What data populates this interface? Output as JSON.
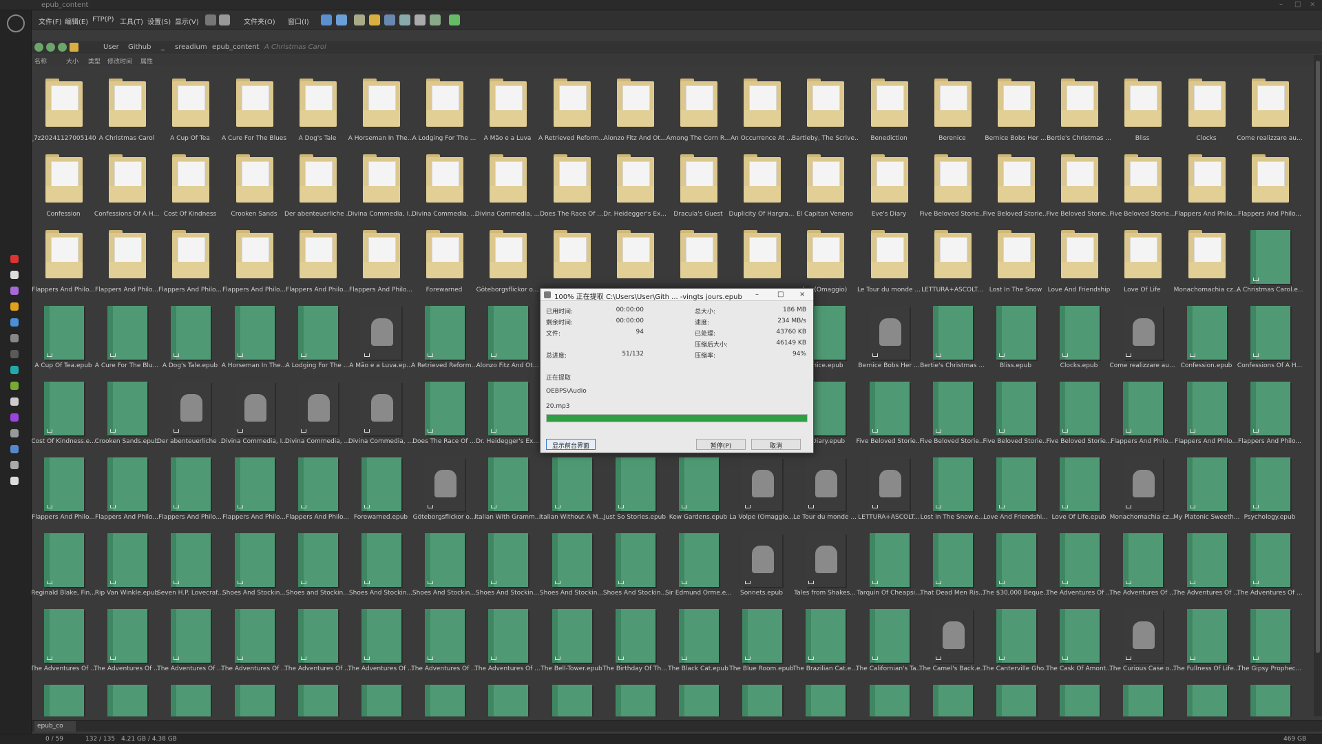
{
  "window": {
    "title": "epub_content"
  },
  "menu": [
    "文件(F)",
    "编辑(E)",
    "FTP(P)",
    "工具(T)",
    "设置(S)",
    "显示(V)",
    "文件夹(O)",
    "窗口(I)"
  ],
  "breadcrumb": [
    "User",
    "Github",
    "_",
    "sreadium",
    "epub_content",
    "A Christmas Carol"
  ],
  "columns": [
    "名称",
    "大小",
    "类型",
    "修改时间",
    "属性"
  ],
  "items": [
    {
      "label": "_7z20241127005140",
      "kind": "folder"
    },
    {
      "label": "A Christmas Carol",
      "kind": "folder"
    },
    {
      "label": "A Cup Of Tea",
      "kind": "folder"
    },
    {
      "label": "A Cure For The Blues",
      "kind": "folder"
    },
    {
      "label": "A Dog's Tale",
      "kind": "folder"
    },
    {
      "label": "A Horseman In The...",
      "kind": "folder"
    },
    {
      "label": "A Lodging For The ...",
      "kind": "folder"
    },
    {
      "label": "A Mão e a Luva",
      "kind": "folder"
    },
    {
      "label": "A Retrieved Reform...",
      "kind": "folder"
    },
    {
      "label": "Alonzo Fitz And Ot...",
      "kind": "folder"
    },
    {
      "label": "Among The Corn R...",
      "kind": "folder"
    },
    {
      "label": "An Occurrence At ...",
      "kind": "folder"
    },
    {
      "label": "Bartleby, The Scrive...",
      "kind": "folder"
    },
    {
      "label": "Benediction",
      "kind": "folder"
    },
    {
      "label": "Berenice",
      "kind": "folder"
    },
    {
      "label": "Bernice Bobs Her ...",
      "kind": "folder"
    },
    {
      "label": "Bertie's Christmas ...",
      "kind": "folder"
    },
    {
      "label": "Bliss",
      "kind": "folder"
    },
    {
      "label": "Clocks",
      "kind": "folder"
    },
    {
      "label": "Come realizzare au...",
      "kind": "folder"
    },
    {
      "label": "Confession",
      "kind": "folder"
    },
    {
      "label": "Confessions Of A H...",
      "kind": "folder"
    },
    {
      "label": "Cost Of Kindness",
      "kind": "folder"
    },
    {
      "label": "Crooken Sands",
      "kind": "folder"
    },
    {
      "label": "Der abenteuerliche ...",
      "kind": "folder"
    },
    {
      "label": "Divina Commedia, I...",
      "kind": "folder"
    },
    {
      "label": "Divina Commedia, ...",
      "kind": "folder"
    },
    {
      "label": "Divina Commedia, ...",
      "kind": "folder"
    },
    {
      "label": "Does The Race Of ...",
      "kind": "folder"
    },
    {
      "label": "Dr. Heidegger's Ex...",
      "kind": "folder"
    },
    {
      "label": "Dracula's Guest",
      "kind": "folder"
    },
    {
      "label": "Duplicity Of Hargra...",
      "kind": "folder"
    },
    {
      "label": "El Capitan Veneno",
      "kind": "folder"
    },
    {
      "label": "Eve's Diary",
      "kind": "folder"
    },
    {
      "label": "Five Beloved Storie...",
      "kind": "folder"
    },
    {
      "label": "Five Beloved Storie...",
      "kind": "folder"
    },
    {
      "label": "Five Beloved Storie...",
      "kind": "folder"
    },
    {
      "label": "Five Beloved Storie...",
      "kind": "folder"
    },
    {
      "label": "Flappers And Philo...",
      "kind": "folder"
    },
    {
      "label": "Flappers And Philo...",
      "kind": "folder"
    },
    {
      "label": "Flappers And Philo...",
      "kind": "folder"
    },
    {
      "label": "Flappers And Philo...",
      "kind": "folder"
    },
    {
      "label": "Flappers And Philo...",
      "kind": "folder"
    },
    {
      "label": "Flappers And Philo...",
      "kind": "folder"
    },
    {
      "label": "Flappers And Philo...",
      "kind": "folder"
    },
    {
      "label": "Flappers And Philo...",
      "kind": "folder"
    },
    {
      "label": "Forewarned",
      "kind": "folder"
    },
    {
      "label": "Göteborgsflickor o...",
      "kind": "folder"
    },
    {
      "label": "",
      "kind": "folder"
    },
    {
      "label": "",
      "kind": "folder"
    },
    {
      "label": "",
      "kind": "folder"
    },
    {
      "label": "",
      "kind": "folder"
    },
    {
      "label": "lpe (Omaggio)",
      "kind": "folder"
    },
    {
      "label": "Le Tour du monde ...",
      "kind": "folder"
    },
    {
      "label": "LETTURA+ASCOLT...",
      "kind": "folder"
    },
    {
      "label": "Lost In The Snow",
      "kind": "folder"
    },
    {
      "label": "Love And Friendship",
      "kind": "folder"
    },
    {
      "label": "Love Of Life",
      "kind": "folder"
    },
    {
      "label": "Monachomachia cz...",
      "kind": "folder"
    },
    {
      "label": "A Christmas Carol.e...",
      "kind": "book"
    },
    {
      "label": "A Cup Of Tea.epub",
      "kind": "book"
    },
    {
      "label": "A Cure For The Blu...",
      "kind": "book"
    },
    {
      "label": "A Dog's Tale.epub",
      "kind": "book"
    },
    {
      "label": "A Horseman In The...",
      "kind": "book"
    },
    {
      "label": "A Lodging For The ...",
      "kind": "book"
    },
    {
      "label": "A Mão e a Luva.ep...",
      "kind": "portrait"
    },
    {
      "label": "A Retrieved Reform...",
      "kind": "book"
    },
    {
      "label": "Alonzo Fitz And Ot...",
      "kind": "book"
    },
    {
      "label": "",
      "kind": "book"
    },
    {
      "label": "",
      "kind": "book"
    },
    {
      "label": "",
      "kind": "book"
    },
    {
      "label": "",
      "kind": "book"
    },
    {
      "label": "renice.epub",
      "kind": "book"
    },
    {
      "label": "Bernice Bobs Her ...",
      "kind": "portrait"
    },
    {
      "label": "Bertie's Christmas ...",
      "kind": "book"
    },
    {
      "label": "Bliss.epub",
      "kind": "book"
    },
    {
      "label": "Clocks.epub",
      "kind": "book"
    },
    {
      "label": "Come realizzare au...",
      "kind": "portrait"
    },
    {
      "label": "Confession.epub",
      "kind": "book"
    },
    {
      "label": "Confessions Of A H...",
      "kind": "book"
    },
    {
      "label": "Cost Of Kindness.e...",
      "kind": "book"
    },
    {
      "label": "Crooken Sands.epub",
      "kind": "book"
    },
    {
      "label": "Der abenteuerliche ...",
      "kind": "portrait"
    },
    {
      "label": "Divina Commedia, I...",
      "kind": "portrait"
    },
    {
      "label": "Divina Commedia, ...",
      "kind": "portrait"
    },
    {
      "label": "Divina Commedia, ...",
      "kind": "portrait"
    },
    {
      "label": "Does The Race Of ...",
      "kind": "book"
    },
    {
      "label": "Dr. Heidegger's Ex...",
      "kind": "book"
    },
    {
      "label": "",
      "kind": "book"
    },
    {
      "label": "",
      "kind": "book"
    },
    {
      "label": "",
      "kind": "book"
    },
    {
      "label": "",
      "kind": "book"
    },
    {
      "label": "'s Diary.epub",
      "kind": "book"
    },
    {
      "label": "Five Beloved Storie...",
      "kind": "book"
    },
    {
      "label": "Five Beloved Storie...",
      "kind": "book"
    },
    {
      "label": "Five Beloved Storie...",
      "kind": "book"
    },
    {
      "label": "Five Beloved Storie...",
      "kind": "book"
    },
    {
      "label": "Flappers And Philo...",
      "kind": "book"
    },
    {
      "label": "Flappers And Philo...",
      "kind": "book"
    },
    {
      "label": "Flappers And Philo...",
      "kind": "book"
    },
    {
      "label": "Flappers And Philo...",
      "kind": "book"
    },
    {
      "label": "Flappers And Philo...",
      "kind": "book"
    },
    {
      "label": "Flappers And Philo...",
      "kind": "book"
    },
    {
      "label": "Flappers And Philo...",
      "kind": "book"
    },
    {
      "label": "Flappers And Philo...",
      "kind": "book"
    },
    {
      "label": "Forewarned.epub",
      "kind": "book"
    },
    {
      "label": "Göteborgsflickor o...",
      "kind": "portrait"
    },
    {
      "label": "Italian With Gramm...",
      "kind": "book"
    },
    {
      "label": "Italian Without A M...",
      "kind": "book"
    },
    {
      "label": "Just So Stories.epub",
      "kind": "book"
    },
    {
      "label": "Kew Gardens.epub",
      "kind": "book"
    },
    {
      "label": "La Volpe (Omaggio...",
      "kind": "portrait"
    },
    {
      "label": "Le Tour du monde ...",
      "kind": "portrait"
    },
    {
      "label": "LETTURA+ASCOLT...",
      "kind": "portrait"
    },
    {
      "label": "Lost In The Snow.e...",
      "kind": "book"
    },
    {
      "label": "Love And Friendshi...",
      "kind": "book"
    },
    {
      "label": "Love Of Life.epub",
      "kind": "book"
    },
    {
      "label": "Monachomachia cz...",
      "kind": "portrait"
    },
    {
      "label": "My Platonic Sweeth...",
      "kind": "book"
    },
    {
      "label": "Psychology.epub",
      "kind": "book"
    },
    {
      "label": "Reginald Blake, Fin...",
      "kind": "book"
    },
    {
      "label": "Rip Van Winkle.epub",
      "kind": "book"
    },
    {
      "label": "Seven H.P. Lovecraf...",
      "kind": "book"
    },
    {
      "label": "Shoes And Stockin...",
      "kind": "book"
    },
    {
      "label": "Shoes and Stockin...",
      "kind": "book"
    },
    {
      "label": "Shoes And Stockin...",
      "kind": "book"
    },
    {
      "label": "Shoes And Stockin...",
      "kind": "book"
    },
    {
      "label": "Shoes And Stockin...",
      "kind": "book"
    },
    {
      "label": "Shoes And Stockin...",
      "kind": "book"
    },
    {
      "label": "Shoes And Stockin...",
      "kind": "book"
    },
    {
      "label": "Sir Edmund Orme.e...",
      "kind": "book"
    },
    {
      "label": "Sonnets.epub",
      "kind": "portrait"
    },
    {
      "label": "Tales from Shakes...",
      "kind": "portrait"
    },
    {
      "label": "Tarquin Of Cheapsi...",
      "kind": "book"
    },
    {
      "label": "That Dead Men Ris...",
      "kind": "book"
    },
    {
      "label": "The $30,000 Beque...",
      "kind": "book"
    },
    {
      "label": "The Adventures Of ...",
      "kind": "book"
    },
    {
      "label": "The Adventures Of ...",
      "kind": "book"
    },
    {
      "label": "The Adventures Of ...",
      "kind": "book"
    },
    {
      "label": "The Adventures Of ...",
      "kind": "book"
    },
    {
      "label": "The Adventures Of ...",
      "kind": "book"
    },
    {
      "label": "The Adventures Of ...",
      "kind": "book"
    },
    {
      "label": "The Adventures Of ...",
      "kind": "book"
    },
    {
      "label": "The Adventures Of ...",
      "kind": "book"
    },
    {
      "label": "The Adventures Of ...",
      "kind": "book"
    },
    {
      "label": "The Adventures Of ...",
      "kind": "book"
    },
    {
      "label": "The Adventures Of ...",
      "kind": "book"
    },
    {
      "label": "The Adventures Of ...",
      "kind": "book"
    },
    {
      "label": "The Bell-Tower.epub",
      "kind": "book"
    },
    {
      "label": "The Birthday Of Th...",
      "kind": "book"
    },
    {
      "label": "The Black Cat.epub",
      "kind": "book"
    },
    {
      "label": "The Blue Room.epub",
      "kind": "book"
    },
    {
      "label": "The Brazilian Cat.e...",
      "kind": "book"
    },
    {
      "label": "The Californian's Ta...",
      "kind": "book"
    },
    {
      "label": "The Camel's Back.e...",
      "kind": "portrait"
    },
    {
      "label": "The Canterville Gho...",
      "kind": "book"
    },
    {
      "label": "The Cask Of Amont...",
      "kind": "book"
    },
    {
      "label": "The Curious Case o...",
      "kind": "portrait"
    },
    {
      "label": "The Fullness Of Life...",
      "kind": "book"
    },
    {
      "label": "The Gipsy Prophec...",
      "kind": "book"
    },
    {
      "label": "",
      "kind": "book"
    },
    {
      "label": "",
      "kind": "book"
    },
    {
      "label": "",
      "kind": "book"
    },
    {
      "label": "",
      "kind": "book"
    },
    {
      "label": "",
      "kind": "book"
    },
    {
      "label": "",
      "kind": "book"
    },
    {
      "label": "",
      "kind": "book"
    },
    {
      "label": "",
      "kind": "book"
    },
    {
      "label": "",
      "kind": "book"
    },
    {
      "label": "",
      "kind": "book"
    },
    {
      "label": "",
      "kind": "book"
    },
    {
      "label": "",
      "kind": "book"
    },
    {
      "label": "",
      "kind": "book"
    },
    {
      "label": "",
      "kind": "book"
    },
    {
      "label": "",
      "kind": "book"
    },
    {
      "label": "",
      "kind": "book"
    },
    {
      "label": "",
      "kind": "book"
    },
    {
      "label": "",
      "kind": "book"
    },
    {
      "label": "",
      "kind": "book"
    },
    {
      "label": "",
      "kind": "book"
    }
  ],
  "dialog": {
    "title": "100% 正在提取 C:\\Users\\User\\Gith ... -vingts jours.epub",
    "elapsed_label": "已用时间:",
    "elapsed": "00:00:00",
    "remaining_label": "剩余时间:",
    "remaining": "00:00:00",
    "files_label": "文件:",
    "files": "94",
    "total_label": "总大小:",
    "total": "186 MB",
    "speed_label": "速度:",
    "speed": "234 MB/s",
    "processed_label": "已处理:",
    "processed": "43760 KB",
    "compressed_label": "压缩后大小:",
    "compressed": "46149 KB",
    "progress_label": "总进度:",
    "progress_count": "51/132",
    "ratio_label": "压缩率:",
    "ratio": "94%",
    "status": "正在提取",
    "path": "OEBPS\\Audio",
    "file": "20.mp3",
    "progress_fraction": 1.0,
    "btn_foreground": "显示前台界面",
    "btn_pause": "暂停(P)",
    "btn_cancel": "取消"
  },
  "tabbar": {
    "tab": "epub_co"
  },
  "statusbar": {
    "selection": "0 / 59",
    "items": "132 / 135",
    "size": "4.21 GB / 4.38 GB",
    "free": "469 GB"
  }
}
